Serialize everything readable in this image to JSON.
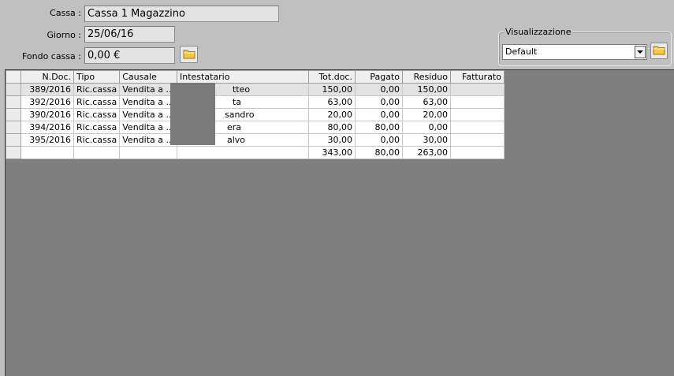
{
  "form": {
    "cassa_label": "Cassa :",
    "cassa_value": "Cassa 1 Magazzino",
    "giorno_label": "Giorno :",
    "giorno_value": "25/06/16",
    "fondo_label": "Fondo cassa :",
    "fondo_value": "0,00 €"
  },
  "view": {
    "group_label": "Visualizzazione",
    "selected": "Default"
  },
  "icons": {
    "folder": "folder-icon",
    "dropdown": "chevron-down-icon"
  },
  "grid": {
    "columns": [
      "N.Doc.",
      "Tipo",
      "Causale",
      "Intestatario",
      "Tot.doc.",
      "Pagato",
      "Residuo",
      "Fatturato"
    ],
    "rows": [
      [
        "389/2016",
        "Ric.cassa",
        "Vendita a ...",
        "tteo",
        "150,00",
        "0,00",
        "150,00",
        ""
      ],
      [
        "392/2016",
        "Ric.cassa",
        "Vendita a ...",
        "ta",
        "63,00",
        "0,00",
        "63,00",
        ""
      ],
      [
        "390/2016",
        "Ric.cassa",
        "Vendita a ...",
        "sandro",
        "20,00",
        "0,00",
        "20,00",
        ""
      ],
      [
        "394/2016",
        "Ric.cassa",
        "Vendita a ...",
        "era",
        "80,00",
        "80,00",
        "0,00",
        ""
      ],
      [
        "395/2016",
        "Ric.cassa",
        "Vendita a ...",
        "alvo",
        "30,00",
        "0,00",
        "30,00",
        ""
      ]
    ],
    "totals": [
      "",
      "",
      "",
      "",
      "343,00",
      "80,00",
      "263,00",
      ""
    ]
  }
}
